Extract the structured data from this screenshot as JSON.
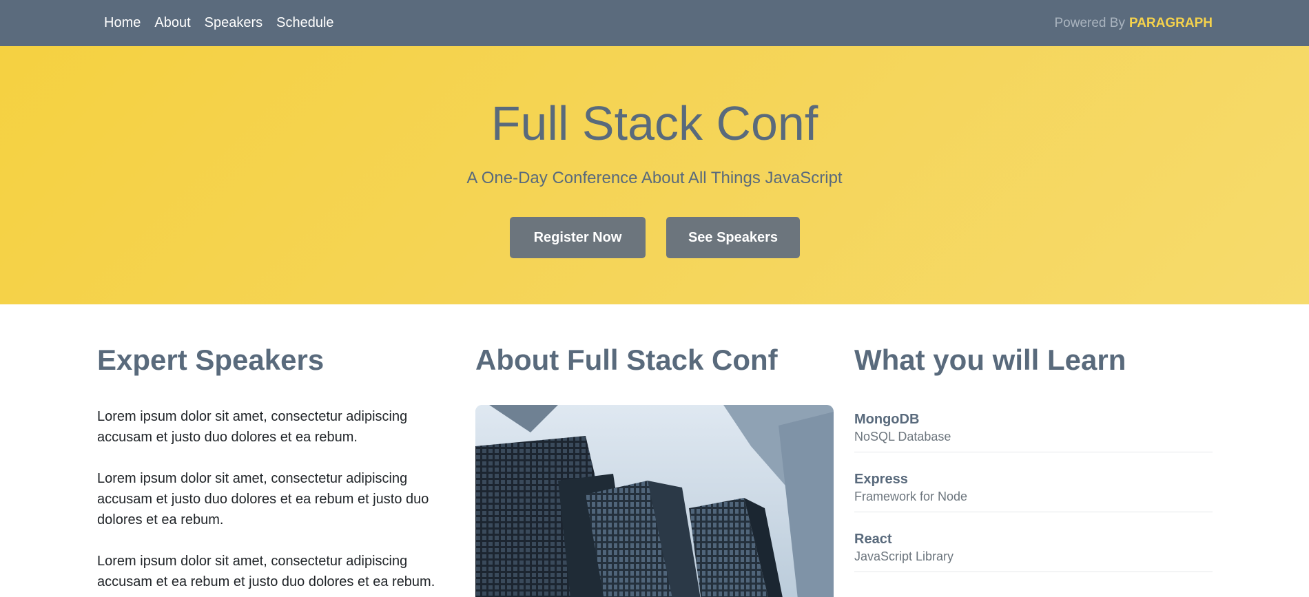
{
  "nav": {
    "links": [
      "Home",
      "About",
      "Speakers",
      "Schedule"
    ],
    "powered_prefix": "Powered By",
    "powered_brand": "PARAGRAPH"
  },
  "hero": {
    "title": "Full Stack Conf",
    "subtitle": "A One-Day Conference About All Things JavaScript",
    "register_label": "Register Now",
    "speakers_label": "See Speakers"
  },
  "speakers_section": {
    "heading": "Expert Speakers",
    "paragraphs": [
      "Lorem ipsum dolor sit amet, consectetur adipiscing accusam et justo duo dolores et ea rebum.",
      "Lorem ipsum dolor sit amet, consectetur adipiscing accusam et justo duo dolores et ea rebum et justo duo dolores et ea rebum.",
      "Lorem ipsum dolor sit amet, consectetur adipiscing accusam et ea rebum et justo duo dolores et ea rebum."
    ]
  },
  "about_section": {
    "heading": "About Full Stack Conf"
  },
  "learn_section": {
    "heading": "What you will Learn",
    "items": [
      {
        "title": "MongoDB",
        "desc": "NoSQL Database"
      },
      {
        "title": "Express",
        "desc": "Framework for Node"
      },
      {
        "title": "React",
        "desc": "JavaScript Library"
      }
    ]
  },
  "colors": {
    "nav_bg": "#5b6b7d",
    "hero_bg": "#f5d141",
    "accent": "#f5d24c",
    "heading": "#596a7c",
    "button": "#6c757d"
  }
}
